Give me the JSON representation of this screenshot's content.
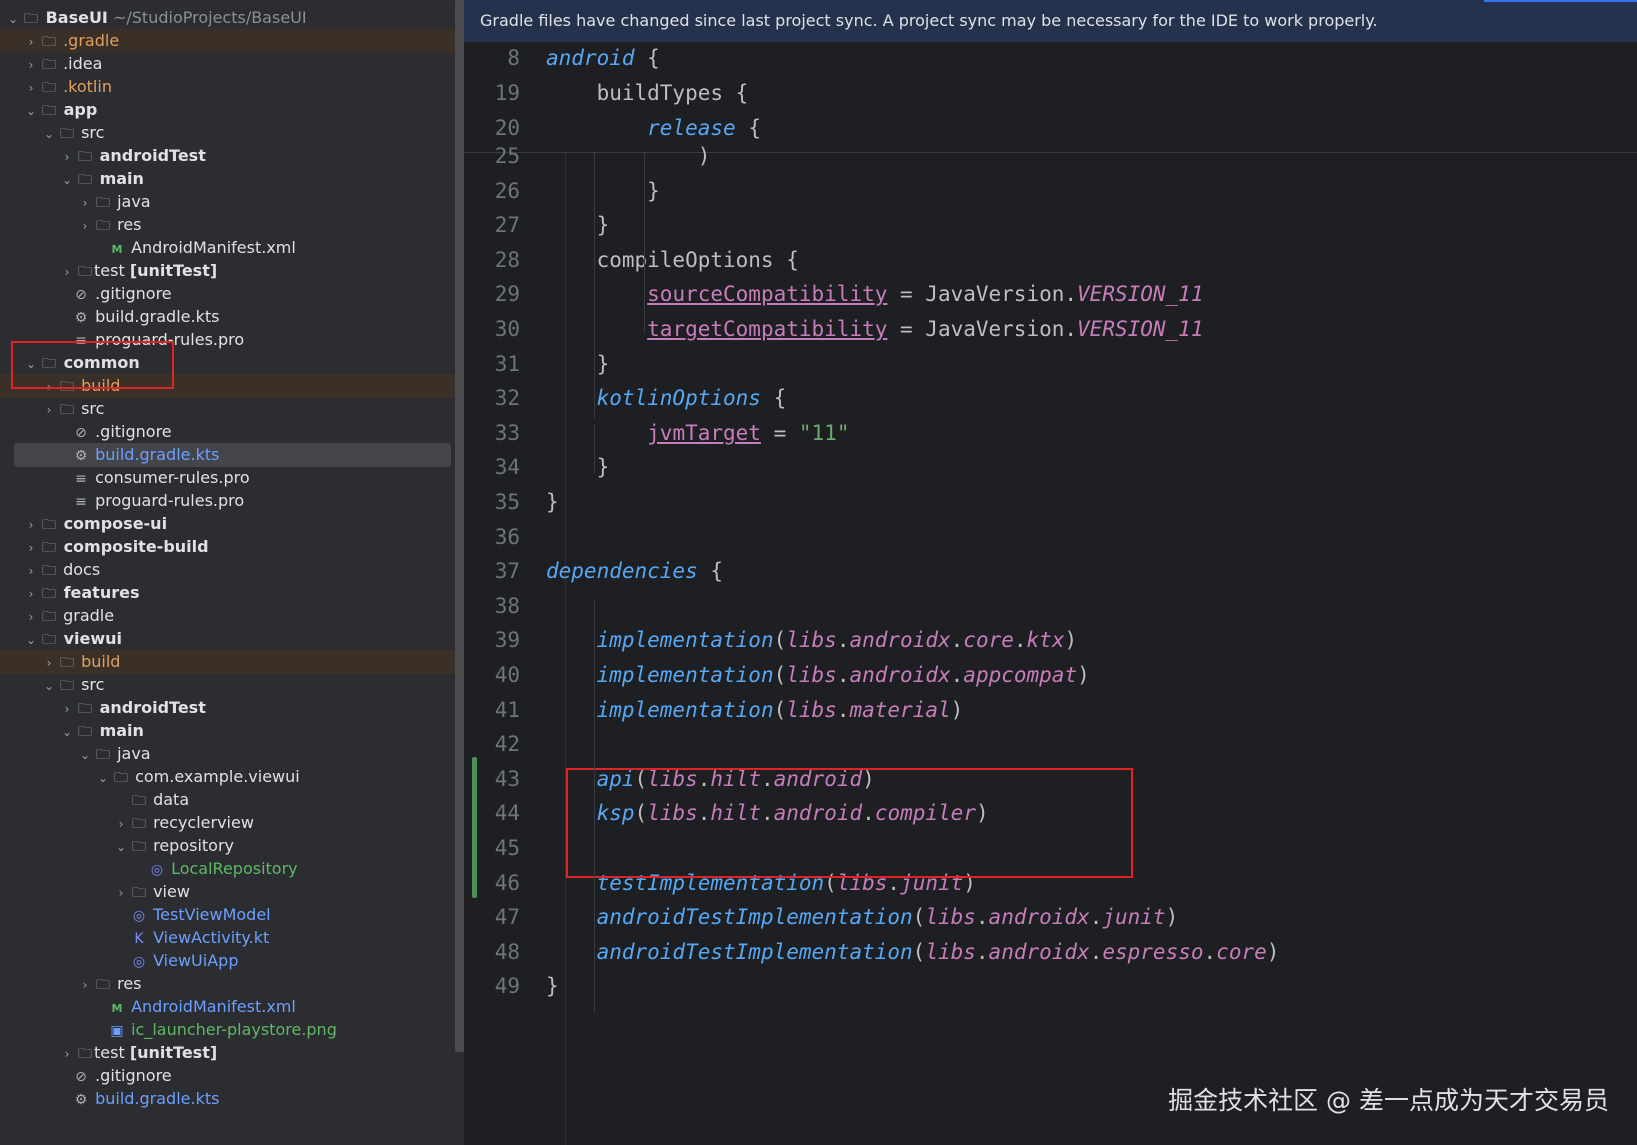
{
  "tree": {
    "rows": [
      {
        "chev": "v",
        "icon": "module-folder-icon",
        "label": "BaseUI",
        "bold": true,
        "path": "~/StudioProjects/BaseUI"
      },
      {
        "chev": ">",
        "icon": "folder-icon",
        "label": ".gradle",
        "style": "orange",
        "hl": "orange"
      },
      {
        "chev": ">",
        "icon": "folder-icon",
        "label": ".idea"
      },
      {
        "chev": ">",
        "icon": "folder-icon",
        "label": ".kotlin",
        "style": "orange"
      },
      {
        "chev": "v",
        "icon": "module-folder-icon",
        "label": "app",
        "bold": true
      },
      {
        "chev": "v",
        "icon": "folder-icon",
        "label": "src"
      },
      {
        "chev": ">",
        "icon": "test-folder-icon",
        "label": "androidTest",
        "bold": true
      },
      {
        "chev": "v",
        "icon": "source-folder-icon",
        "label": "main",
        "bold": true
      },
      {
        "chev": ">",
        "icon": "source-folder-icon",
        "label": "java"
      },
      {
        "chev": ">",
        "icon": "resource-folder-icon",
        "label": "res"
      },
      {
        "chev": "",
        "icon": "xml-file-icon",
        "label": "AndroidManifest.xml"
      },
      {
        "chev": ">",
        "icon": "test-folder-icon",
        "label": "test [unitTest]",
        "boldpart": "[unitTest]"
      },
      {
        "chev": "",
        "icon": "ignore-file-icon",
        "label": ".gitignore"
      },
      {
        "chev": "",
        "icon": "gradle-file-icon",
        "label": "build.gradle.kts"
      },
      {
        "chev": "",
        "icon": "text-file-icon",
        "label": "proguard-rules.pro"
      },
      {
        "chev": "v",
        "icon": "module-folder-icon",
        "label": "common",
        "bold": true
      },
      {
        "chev": ">",
        "icon": "folder-icon",
        "label": "build",
        "style": "orange",
        "hl": "orange"
      },
      {
        "chev": ">",
        "icon": "folder-icon",
        "label": "src"
      },
      {
        "chev": "",
        "icon": "ignore-file-icon",
        "label": ".gitignore"
      },
      {
        "chev": "",
        "icon": "gradle-file-icon",
        "label": "build.gradle.kts",
        "style": "blue",
        "hl": "select"
      },
      {
        "chev": "",
        "icon": "text-file-icon",
        "label": "consumer-rules.pro"
      },
      {
        "chev": "",
        "icon": "text-file-icon",
        "label": "proguard-rules.pro"
      },
      {
        "chev": ">",
        "icon": "module-folder-icon",
        "label": "compose-ui",
        "bold": true
      },
      {
        "chev": ">",
        "icon": "module-folder-icon",
        "label": "composite-build",
        "bold": true
      },
      {
        "chev": ">",
        "icon": "folder-icon",
        "label": "docs"
      },
      {
        "chev": ">",
        "icon": "module-folder-icon",
        "label": "features",
        "bold": true
      },
      {
        "chev": ">",
        "icon": "folder-icon",
        "label": "gradle"
      },
      {
        "chev": "v",
        "icon": "module-folder-icon",
        "label": "viewui",
        "bold": true
      },
      {
        "chev": ">",
        "icon": "folder-icon",
        "label": "build",
        "style": "orange",
        "hl": "orange"
      },
      {
        "chev": "v",
        "icon": "folder-icon",
        "label": "src"
      },
      {
        "chev": ">",
        "icon": "test-folder-icon",
        "label": "androidTest",
        "bold": true
      },
      {
        "chev": "v",
        "icon": "source-folder-icon",
        "label": "main",
        "bold": true
      },
      {
        "chev": "v",
        "icon": "source-folder-icon",
        "label": "java"
      },
      {
        "chev": "v",
        "icon": "package-icon",
        "label": "com.example.viewui"
      },
      {
        "chev": "",
        "icon": "package-icon",
        "label": "data"
      },
      {
        "chev": ">",
        "icon": "package-icon",
        "label": "recyclerview"
      },
      {
        "chev": "v",
        "icon": "package-icon",
        "label": "repository"
      },
      {
        "chev": "",
        "icon": "kotlin-class-icon",
        "label": "LocalRepository",
        "style": "green"
      },
      {
        "chev": ">",
        "icon": "package-icon",
        "label": "view"
      },
      {
        "chev": "",
        "icon": "kotlin-class-icon",
        "label": "TestViewModel",
        "style": "blue"
      },
      {
        "chev": "",
        "icon": "kotlin-file-icon",
        "label": "ViewActivity.kt",
        "style": "blue"
      },
      {
        "chev": "",
        "icon": "kotlin-class-icon",
        "label": "ViewUiApp",
        "style": "blue"
      },
      {
        "chev": ">",
        "icon": "resource-folder-icon",
        "label": "res"
      },
      {
        "chev": "",
        "icon": "xml-file-icon",
        "label": "AndroidManifest.xml",
        "style": "blue"
      },
      {
        "chev": "",
        "icon": "image-file-icon",
        "label": "ic_launcher-playstore.png",
        "style": "green"
      },
      {
        "chev": ">",
        "icon": "test-folder-icon",
        "label": "test [unitTest]",
        "boldpart": "[unitTest]"
      },
      {
        "chev": "",
        "icon": "ignore-file-icon",
        "label": ".gitignore"
      },
      {
        "chev": "",
        "icon": "gradle-file-icon",
        "label": "build.gradle.kts",
        "style": "blue"
      }
    ]
  },
  "editor": {
    "banner": "Gradle files have changed since last project sync. A project sync may be necessary for the IDE to work properly.",
    "sticky_lines": [
      {
        "n": "8",
        "tokens": [
          [
            "kw",
            "android"
          ],
          [
            "plain",
            " {"
          ]
        ]
      },
      {
        "n": "19",
        "tokens": [
          [
            "plain",
            "    buildTypes {"
          ]
        ]
      },
      {
        "n": "20",
        "tokens": [
          [
            "plain",
            "        "
          ],
          [
            "kw",
            "release"
          ],
          [
            "plain",
            " {"
          ]
        ]
      }
    ],
    "lines": [
      {
        "n": "25",
        "tokens": [
          [
            "plain",
            "            )"
          ]
        ]
      },
      {
        "n": "26",
        "tokens": [
          [
            "plain",
            "        }"
          ]
        ]
      },
      {
        "n": "27",
        "tokens": [
          [
            "plain",
            "    }"
          ]
        ]
      },
      {
        "n": "28",
        "tokens": [
          [
            "plain",
            "    compileOptions {"
          ]
        ]
      },
      {
        "n": "29",
        "tokens": [
          [
            "plain",
            "        "
          ],
          [
            "ref",
            "sourceCompatibility"
          ],
          [
            "plain",
            " = JavaVersion."
          ],
          [
            "konst",
            "VERSION_11"
          ]
        ]
      },
      {
        "n": "30",
        "tokens": [
          [
            "plain",
            "        "
          ],
          [
            "ref",
            "targetCompatibility"
          ],
          [
            "plain",
            " = JavaVersion."
          ],
          [
            "konst",
            "VERSION_11"
          ]
        ]
      },
      {
        "n": "31",
        "tokens": [
          [
            "plain",
            "    }"
          ]
        ]
      },
      {
        "n": "32",
        "tokens": [
          [
            "plain",
            "    "
          ],
          [
            "kw",
            "kotlinOptions"
          ],
          [
            "plain",
            " {"
          ]
        ]
      },
      {
        "n": "33",
        "tokens": [
          [
            "plain",
            "        "
          ],
          [
            "ref",
            "jvmTarget"
          ],
          [
            "plain",
            " = "
          ],
          [
            "str",
            "\"11\""
          ]
        ]
      },
      {
        "n": "34",
        "tokens": [
          [
            "plain",
            "    }"
          ]
        ]
      },
      {
        "n": "35",
        "tokens": [
          [
            "plain",
            "}"
          ]
        ]
      },
      {
        "n": "36",
        "tokens": []
      },
      {
        "n": "37",
        "tokens": [
          [
            "kw",
            "dependencies"
          ],
          [
            "plain",
            " {"
          ]
        ]
      },
      {
        "n": "38",
        "tokens": []
      },
      {
        "n": "39",
        "tokens": [
          [
            "plain",
            "    "
          ],
          [
            "fn",
            "implementation"
          ],
          [
            "plain",
            "("
          ],
          [
            "libs",
            "libs"
          ],
          [
            "plain",
            "."
          ],
          [
            "libs",
            "androidx"
          ],
          [
            "plain",
            "."
          ],
          [
            "libs",
            "core"
          ],
          [
            "plain",
            "."
          ],
          [
            "libs",
            "ktx"
          ],
          [
            "plain",
            ")"
          ]
        ]
      },
      {
        "n": "40",
        "tokens": [
          [
            "plain",
            "    "
          ],
          [
            "fn",
            "implementation"
          ],
          [
            "plain",
            "("
          ],
          [
            "libs",
            "libs"
          ],
          [
            "plain",
            "."
          ],
          [
            "libs",
            "androidx"
          ],
          [
            "plain",
            "."
          ],
          [
            "libs",
            "appcompat"
          ],
          [
            "plain",
            ")"
          ]
        ]
      },
      {
        "n": "41",
        "tokens": [
          [
            "plain",
            "    "
          ],
          [
            "fn",
            "implementation"
          ],
          [
            "plain",
            "("
          ],
          [
            "libs",
            "libs"
          ],
          [
            "plain",
            "."
          ],
          [
            "libs",
            "material"
          ],
          [
            "plain",
            ")"
          ]
        ]
      },
      {
        "n": "42",
        "tokens": []
      },
      {
        "n": "43",
        "tokens": [
          [
            "plain",
            "    "
          ],
          [
            "fn",
            "api"
          ],
          [
            "plain",
            "("
          ],
          [
            "libs",
            "libs"
          ],
          [
            "plain",
            "."
          ],
          [
            "libs",
            "hilt"
          ],
          [
            "plain",
            "."
          ],
          [
            "libs",
            "android"
          ],
          [
            "plain",
            ")"
          ]
        ]
      },
      {
        "n": "44",
        "tokens": [
          [
            "plain",
            "    "
          ],
          [
            "fn",
            "ksp"
          ],
          [
            "plain",
            "("
          ],
          [
            "libs",
            "libs"
          ],
          [
            "plain",
            "."
          ],
          [
            "libs",
            "hilt"
          ],
          [
            "plain",
            "."
          ],
          [
            "libs",
            "android"
          ],
          [
            "plain",
            "."
          ],
          [
            "libs",
            "compiler"
          ],
          [
            "plain",
            ")"
          ]
        ]
      },
      {
        "n": "45",
        "tokens": []
      },
      {
        "n": "46",
        "tokens": [
          [
            "plain",
            "    "
          ],
          [
            "fn",
            "testImplementation"
          ],
          [
            "plain",
            "("
          ],
          [
            "libs",
            "libs"
          ],
          [
            "plain",
            "."
          ],
          [
            "libs",
            "junit"
          ],
          [
            "plain",
            ")"
          ]
        ]
      },
      {
        "n": "47",
        "tokens": [
          [
            "plain",
            "    "
          ],
          [
            "fn",
            "androidTestImplementation"
          ],
          [
            "plain",
            "("
          ],
          [
            "libs",
            "libs"
          ],
          [
            "plain",
            "."
          ],
          [
            "libs",
            "androidx"
          ],
          [
            "plain",
            "."
          ],
          [
            "libs",
            "junit"
          ],
          [
            "plain",
            ")"
          ]
        ]
      },
      {
        "n": "48",
        "tokens": [
          [
            "plain",
            "    "
          ],
          [
            "fn",
            "androidTestImplementation"
          ],
          [
            "plain",
            "("
          ],
          [
            "libs",
            "libs"
          ],
          [
            "plain",
            "."
          ],
          [
            "libs",
            "androidx"
          ],
          [
            "plain",
            "."
          ],
          [
            "libs",
            "espresso"
          ],
          [
            "plain",
            "."
          ],
          [
            "libs",
            "core"
          ],
          [
            "plain",
            ")"
          ]
        ]
      },
      {
        "n": "49",
        "tokens": [
          [
            "plain",
            "}"
          ]
        ]
      }
    ]
  },
  "watermark": "掘金技术社区 @ 差一点成为天才交易员",
  "colors": {
    "keyword": "#56a8f5",
    "property": "#c77dbb",
    "string": "#6aab73",
    "highlight_box": "#e02424",
    "vcs_added": "#4e8f5a"
  }
}
